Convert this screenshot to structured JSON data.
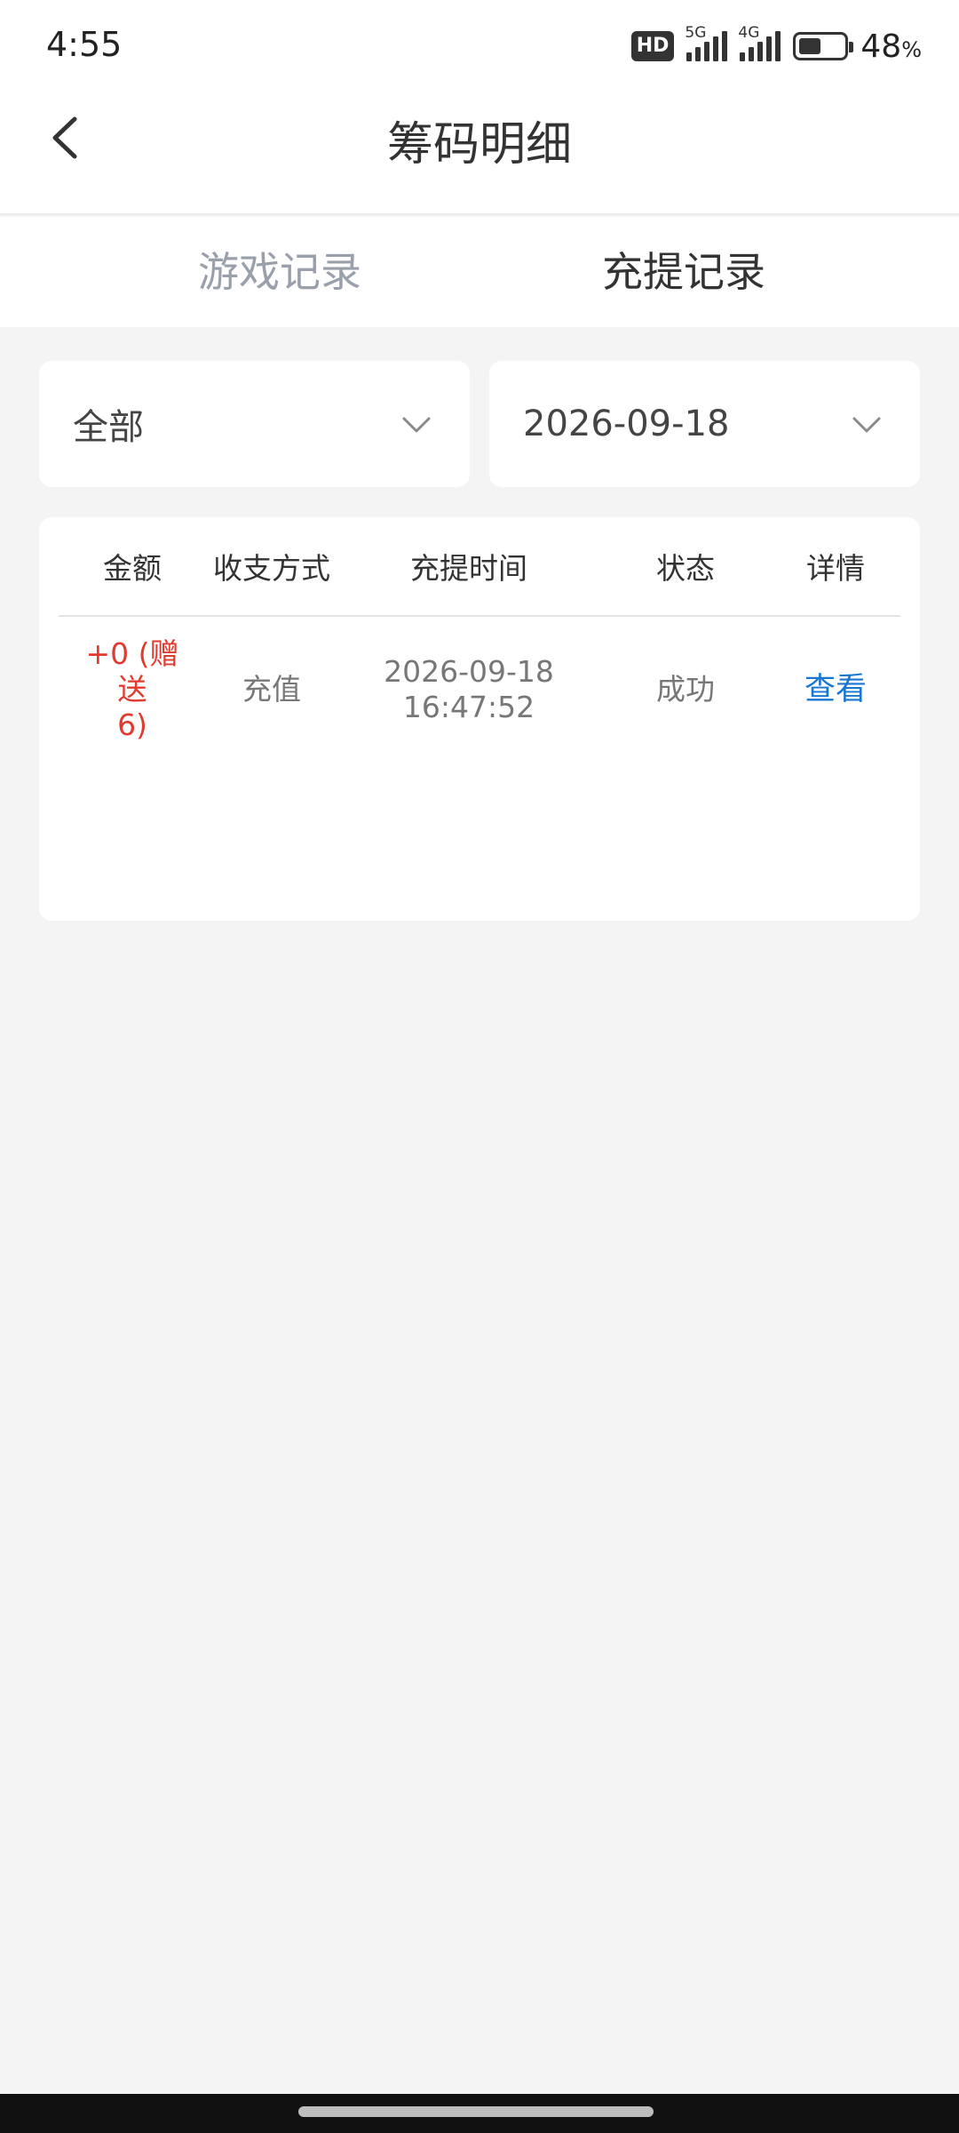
{
  "status_bar": {
    "time": "4:55",
    "hd_badge": "HD",
    "network_1": "5G",
    "network_2": "4G",
    "battery_percent": "48",
    "battery_unit": "%",
    "battery_level": 0.48
  },
  "header": {
    "title": "筹码明细",
    "back_icon": "chevron-left-icon"
  },
  "tabs": [
    {
      "label": "游戏记录",
      "active": false
    },
    {
      "label": "充提记录",
      "active": true
    }
  ],
  "filters": {
    "type": {
      "selected": "全部",
      "icon": "chevron-down-icon"
    },
    "date": {
      "selected": "2026-09-18",
      "icon": "chevron-down-icon"
    }
  },
  "table": {
    "headers": [
      "金额",
      "收支方式",
      "充提时间",
      "状态",
      "详情"
    ],
    "rows": [
      {
        "amount_line1": "+0 (赠送",
        "amount_line2": "6)",
        "method": "充值",
        "date": "2026-09-18",
        "time": "16:47:52",
        "status": "成功",
        "action": "查看"
      }
    ]
  },
  "colors": {
    "accent_link": "#1976d2",
    "amount_red": "#e23a2e",
    "inactive_tab": "#9aa0ab",
    "background": "#f4f4f4"
  }
}
